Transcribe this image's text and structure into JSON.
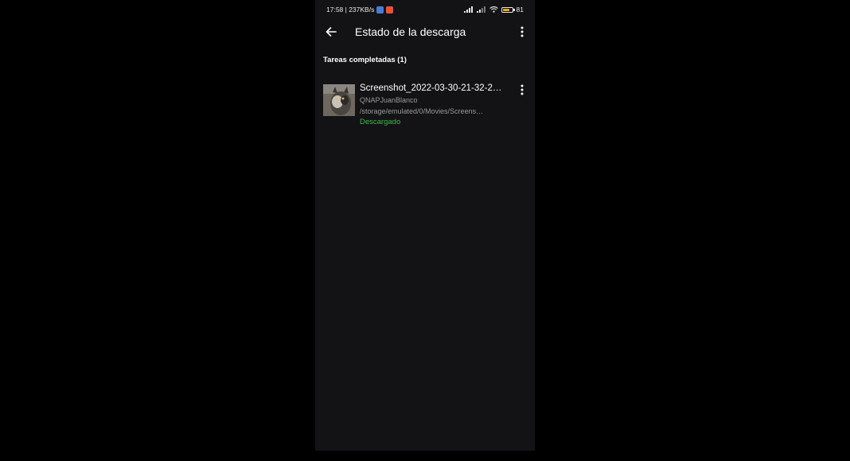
{
  "status_bar": {
    "time_speed": "17:58 | 237KB/s",
    "battery_text": "81",
    "battery_level": 0.81,
    "icons": [
      "app-notification-icon",
      "recording-icon",
      "signal-icon",
      "signal-icon",
      "wifi-icon",
      "battery-icon"
    ]
  },
  "app_bar": {
    "title": "Estado de la descarga",
    "back_icon": "arrow-back-icon",
    "menu_icon": "more-vert-icon"
  },
  "section": {
    "header": "Tareas completadas (1)"
  },
  "downloads": [
    {
      "title": "Screenshot_2022-03-30-21-32-2…",
      "source": "QNAPJuanBlanco",
      "path": "/storage/emulated/0/Movies/Screens…",
      "status": "Descargado",
      "thumbnail_icon": "cat-thumbnail"
    }
  ],
  "colors": {
    "background": "#000000",
    "screen": "#131315",
    "status_green": "#3fba4c",
    "secondary_text": "#9a9a9a",
    "battery": "#f2a900"
  }
}
